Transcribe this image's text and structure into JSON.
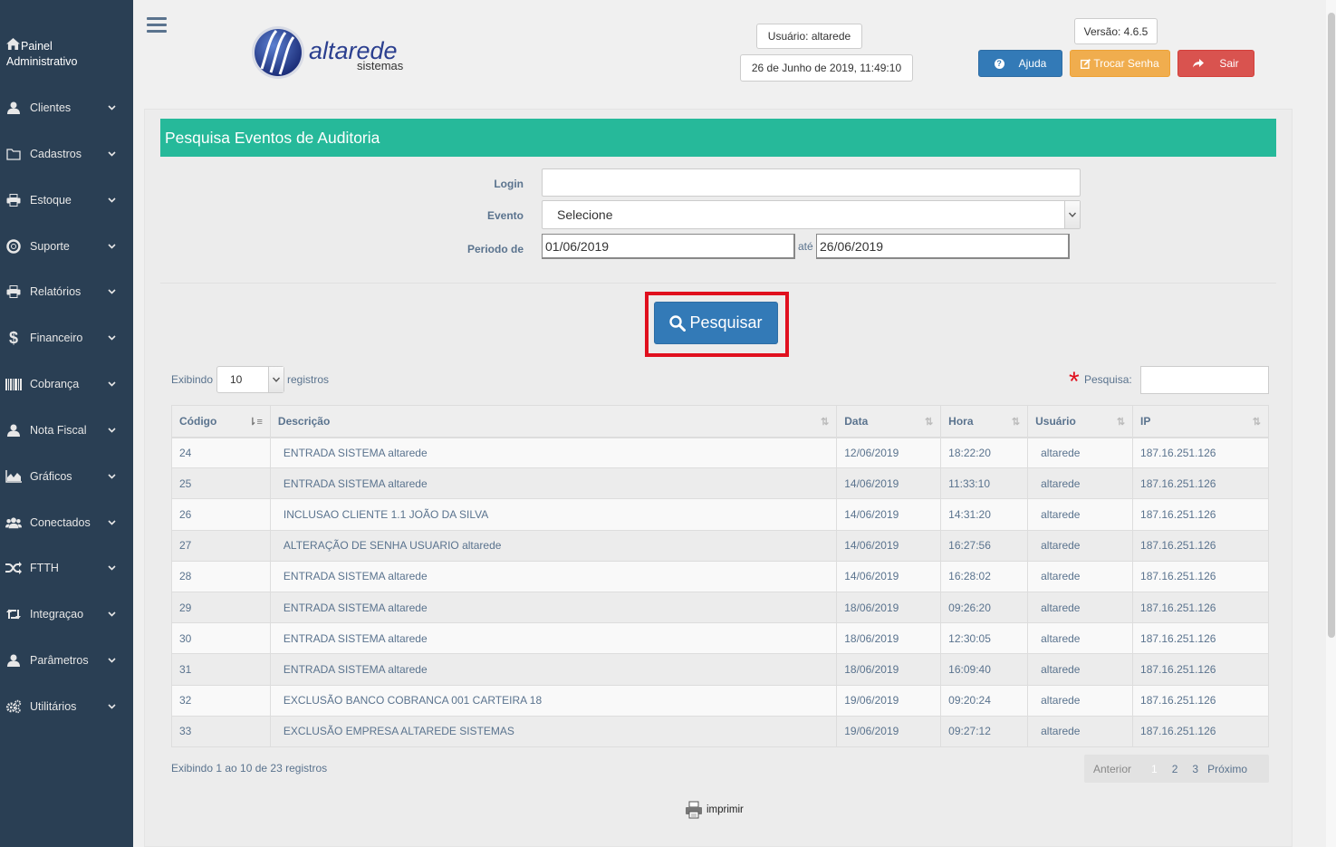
{
  "sidebar": {
    "title_line1": "Painel",
    "title_line2": "Administrativo",
    "items": [
      {
        "label": "Clientes",
        "icon": "user-icon"
      },
      {
        "label": "Cadastros",
        "icon": "folder-icon"
      },
      {
        "label": "Estoque",
        "icon": "print-icon"
      },
      {
        "label": "Suporte",
        "icon": "lifebuoy-icon"
      },
      {
        "label": "Relatórios",
        "icon": "print-icon"
      },
      {
        "label": "Financeiro",
        "icon": "dollar-icon"
      },
      {
        "label": "Cobrança",
        "icon": "barcode-icon"
      },
      {
        "label": "Nota Fiscal",
        "icon": "user-icon"
      },
      {
        "label": "Gráficos",
        "icon": "area-chart-icon"
      },
      {
        "label": "Conectados",
        "icon": "users-icon"
      },
      {
        "label": "FTTH",
        "icon": "random-icon"
      },
      {
        "label": "Integraçao",
        "icon": "retweet-icon"
      },
      {
        "label": "Parâmetros",
        "icon": "user-icon"
      },
      {
        "label": "Utilitários",
        "icon": "cogs-icon"
      }
    ]
  },
  "header": {
    "logo_word": "altarede",
    "logo_sub": "sistemas",
    "user": "Usuário: altarede",
    "datetime": "26 de Junho de 2019, 11:49:10",
    "version": "Versão: 4.6.5",
    "help": "Ajuda",
    "change_password": "Trocar Senha",
    "logout": "Sair",
    "colors": {
      "help": "#337ab7",
      "change_password": "#f0ad4e",
      "logout": "#d9534f"
    }
  },
  "form": {
    "title": "Pesquisa Eventos de Auditoria",
    "login_label": "Login",
    "login_value": "",
    "event_label": "Evento",
    "event_value": "Selecione",
    "period_label": "Periodo de",
    "date_from": "01/06/2019",
    "until_label": "até",
    "date_to": "26/06/2019",
    "search_button": "Pesquisar",
    "accent": "#26b99a"
  },
  "table_controls": {
    "showing": "Exibindo",
    "page_size": "10",
    "records": "registros",
    "search_label": "Pesquisa:",
    "search_value": ""
  },
  "table": {
    "columns": [
      "Código",
      "Descrição",
      "Data",
      "Hora",
      "Usuário",
      "IP"
    ],
    "rows": [
      [
        "24",
        "ENTRADA SISTEMA altarede",
        "12/06/2019",
        "18:22:20",
        "altarede",
        "187.16.251.126"
      ],
      [
        "25",
        "ENTRADA SISTEMA altarede",
        "14/06/2019",
        "11:33:10",
        "altarede",
        "187.16.251.126"
      ],
      [
        "26",
        "INCLUSAO CLIENTE 1.1 JOÃO DA SILVA",
        "14/06/2019",
        "14:31:20",
        "altarede",
        "187.16.251.126"
      ],
      [
        "27",
        "ALTERAÇÃO DE SENHA USUARIO altarede",
        "14/06/2019",
        "16:27:56",
        "altarede",
        "187.16.251.126"
      ],
      [
        "28",
        "ENTRADA SISTEMA altarede",
        "14/06/2019",
        "16:28:02",
        "altarede",
        "187.16.251.126"
      ],
      [
        "29",
        "ENTRADA SISTEMA altarede",
        "18/06/2019",
        "09:26:20",
        "altarede",
        "187.16.251.126"
      ],
      [
        "30",
        "ENTRADA SISTEMA altarede",
        "18/06/2019",
        "12:30:05",
        "altarede",
        "187.16.251.126"
      ],
      [
        "31",
        "ENTRADA SISTEMA altarede",
        "18/06/2019",
        "16:09:40",
        "altarede",
        "187.16.251.126"
      ],
      [
        "32",
        "EXCLUSÃO BANCO COBRANCA 001 CARTEIRA 18",
        "19/06/2019",
        "09:20:24",
        "altarede",
        "187.16.251.126"
      ],
      [
        "33",
        "EXCLUSÃO EMPRESA ALTAREDE SISTEMAS",
        "19/06/2019",
        "09:27:12",
        "altarede",
        "187.16.251.126"
      ]
    ]
  },
  "footer": {
    "info": "Exibindo 1 ao 10 de 23 registros",
    "prev": "Anterior",
    "pages": [
      "1",
      "2",
      "3"
    ],
    "current_page": "1",
    "next": "Próximo",
    "print": "imprimir"
  }
}
